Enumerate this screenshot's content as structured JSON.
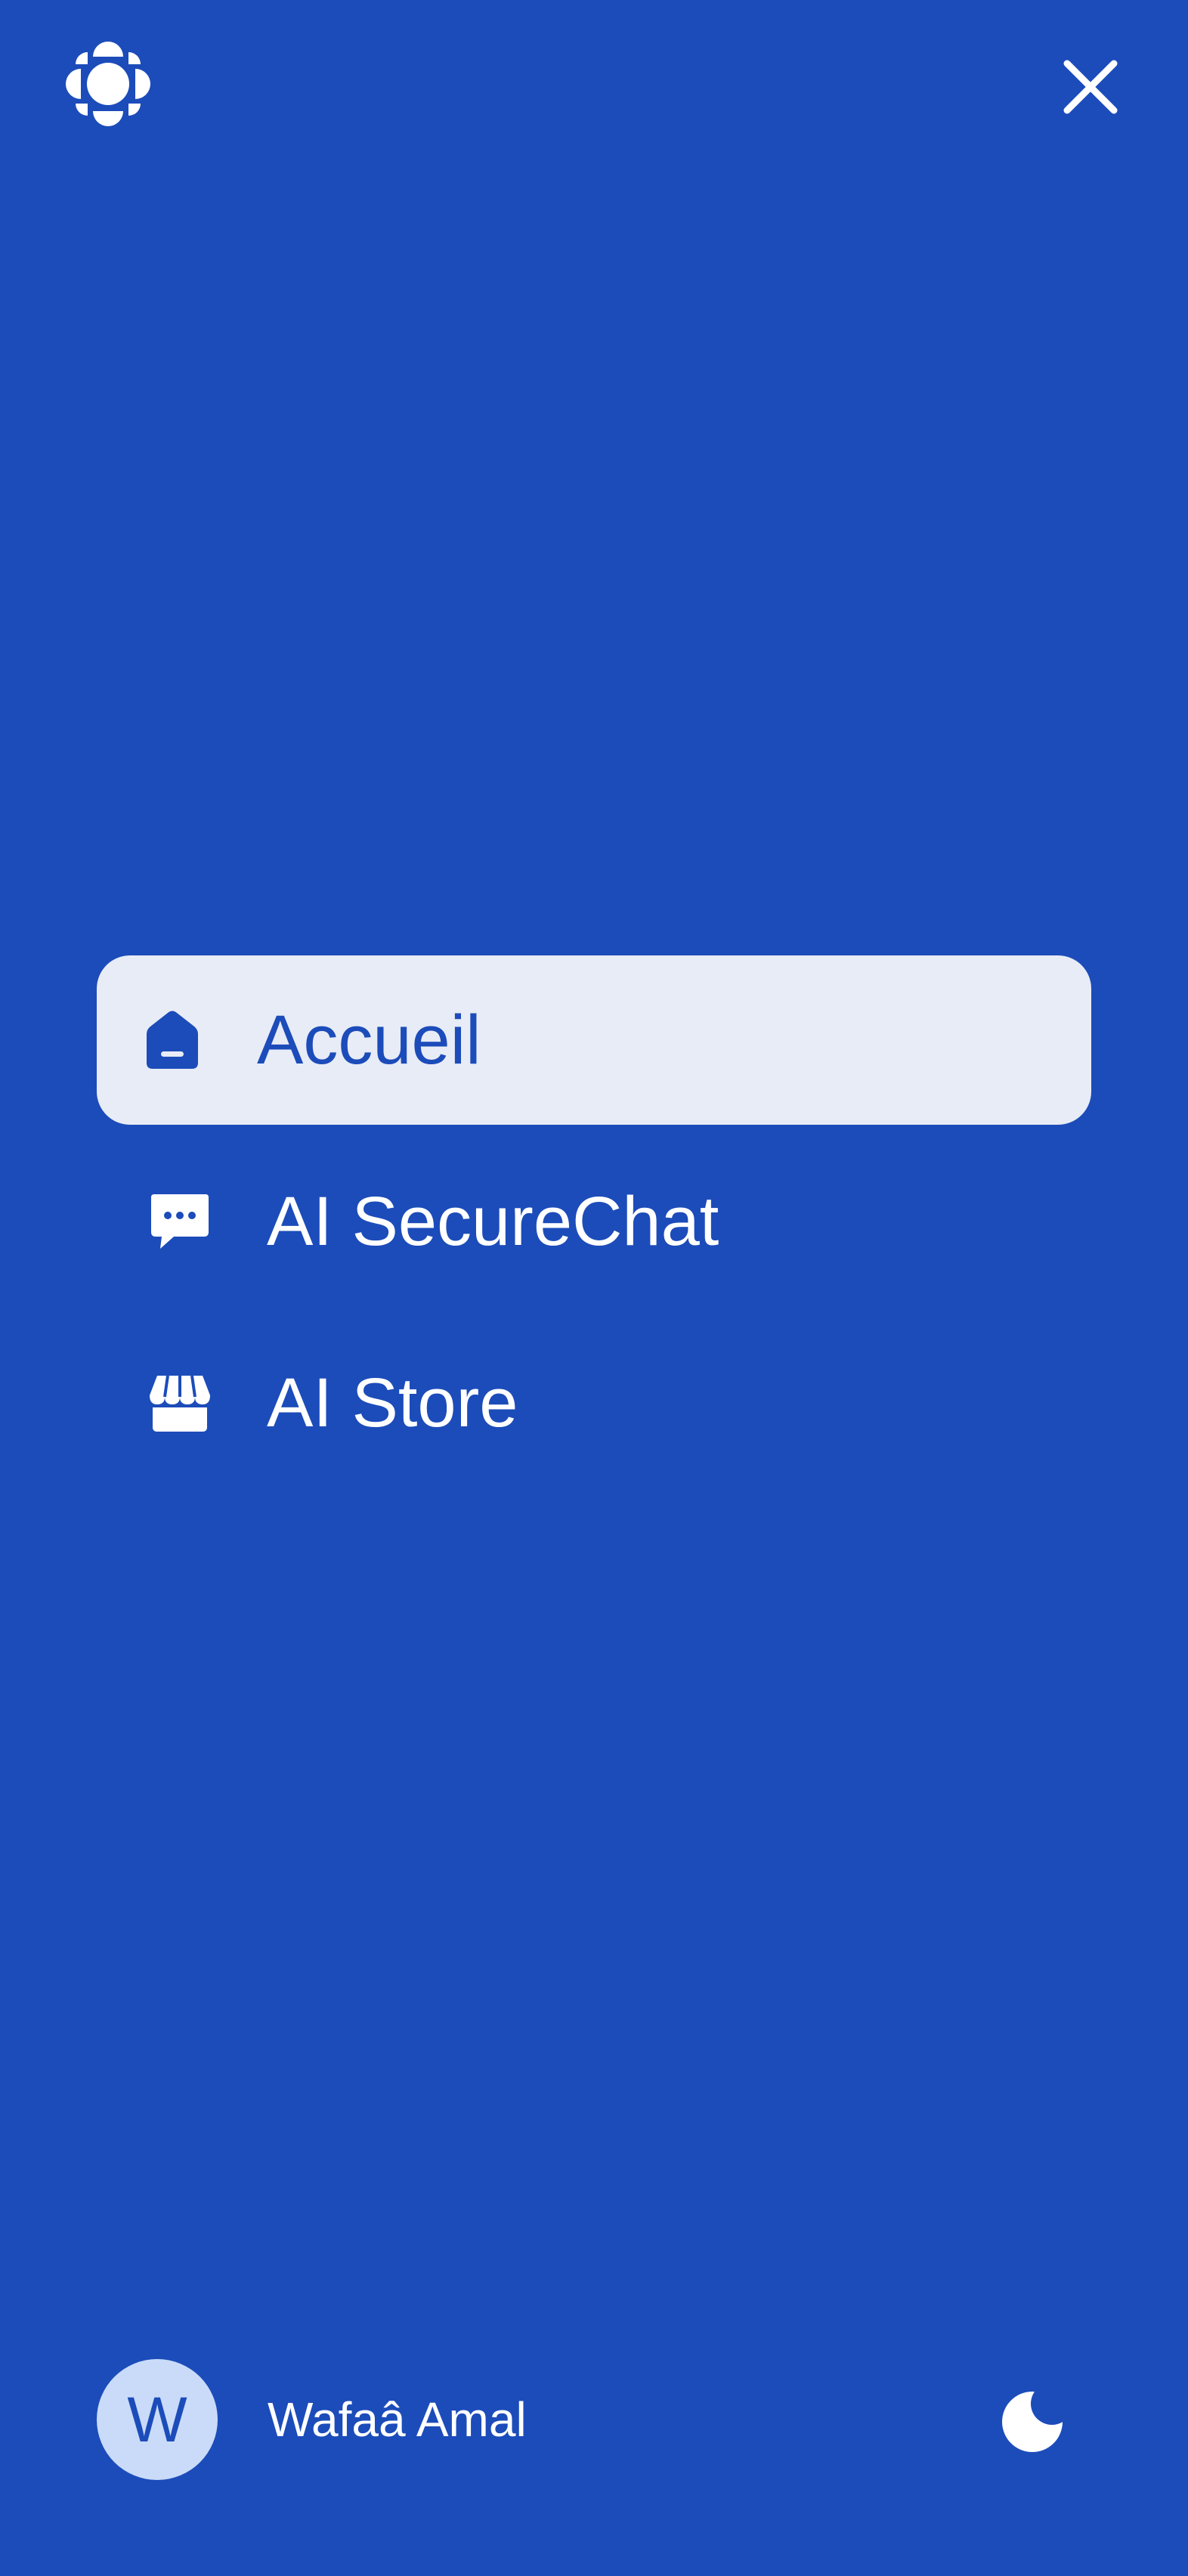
{
  "colors": {
    "background": "#1C4CBA",
    "foreground": "#FFFFFF",
    "active_item_bg": "#E8ECF6",
    "avatar_bg": "#C9DBF8"
  },
  "header": {
    "logo_icon": "gem-logo-icon",
    "close_icon": "close-icon"
  },
  "nav": {
    "items": [
      {
        "label": "Accueil",
        "icon": "home-icon",
        "active": true
      },
      {
        "label": "AI SecureChat",
        "icon": "chat-bubble-icon",
        "active": false
      },
      {
        "label": "AI Store",
        "icon": "store-icon",
        "active": false
      }
    ]
  },
  "user": {
    "initial": "W",
    "name": "Wafaâ Amal"
  },
  "theme_toggle": {
    "icon": "moon-icon"
  }
}
